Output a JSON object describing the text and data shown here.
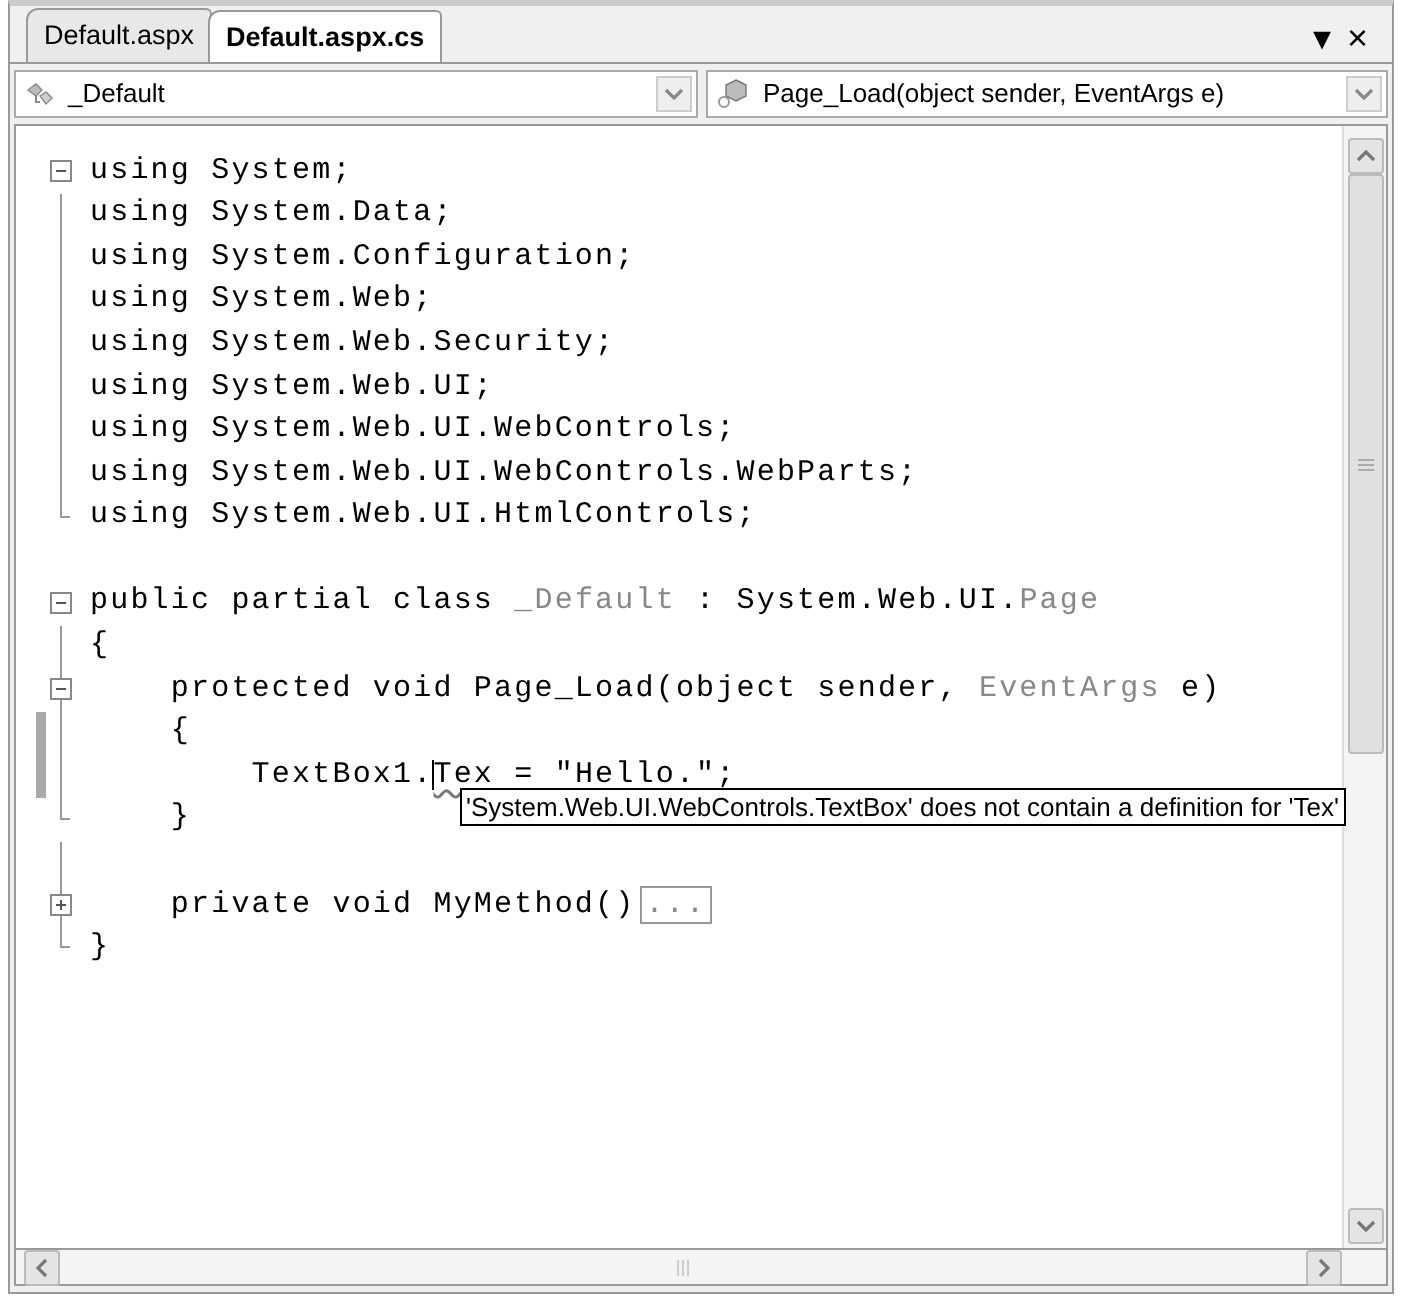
{
  "tabs": [
    {
      "label": "Default.aspx",
      "selected": false
    },
    {
      "label": "Default.aspx.cs",
      "selected": true
    }
  ],
  "window_buttons": {
    "menu": "▾",
    "close": "×"
  },
  "type_dropdown": {
    "value": "_Default"
  },
  "member_dropdown": {
    "value": "Page_Load(object sender, EventArgs e)"
  },
  "code_lines": [
    {
      "kind": "fold_start",
      "expanded": true,
      "changed": false,
      "tokens": [
        {
          "text": "using System;",
          "kind": "code"
        }
      ]
    },
    {
      "kind": "guide",
      "changed": false,
      "tokens": [
        {
          "text": "using System.Data;",
          "kind": "code"
        }
      ]
    },
    {
      "kind": "guide",
      "changed": false,
      "tokens": [
        {
          "text": "using System.Configuration;",
          "kind": "code"
        }
      ]
    },
    {
      "kind": "guide",
      "changed": false,
      "tokens": [
        {
          "text": "using System.Web;",
          "kind": "code"
        }
      ]
    },
    {
      "kind": "guide",
      "changed": false,
      "tokens": [
        {
          "text": "using System.Web.Security;",
          "kind": "code"
        }
      ]
    },
    {
      "kind": "guide",
      "changed": false,
      "tokens": [
        {
          "text": "using System.Web.UI;",
          "kind": "code"
        }
      ]
    },
    {
      "kind": "guide",
      "changed": false,
      "tokens": [
        {
          "text": "using System.Web.UI.WebControls;",
          "kind": "code"
        }
      ]
    },
    {
      "kind": "guide",
      "changed": false,
      "tokens": [
        {
          "text": "using System.Web.UI.WebControls.WebParts;",
          "kind": "code"
        }
      ]
    },
    {
      "kind": "guide_end",
      "changed": false,
      "tokens": [
        {
          "text": "using System.Web.UI.HtmlControls;",
          "kind": "code"
        }
      ]
    },
    {
      "kind": "plain",
      "changed": false
    },
    {
      "kind": "fold_start",
      "expanded": true,
      "changed": false,
      "tokens": [
        {
          "text": "public partial class ",
          "kind": "code"
        },
        {
          "text": "_Default",
          "kind": "type"
        },
        {
          "text": " : System.Web.UI.",
          "kind": "code"
        },
        {
          "text": "Page",
          "kind": "type"
        }
      ]
    },
    {
      "kind": "guide",
      "changed": false,
      "tokens": [
        {
          "text": "{",
          "kind": "code"
        }
      ]
    },
    {
      "kind": "fold_start",
      "expanded": true,
      "changed": false,
      "tokens": [
        {
          "text": "    protected void Page_Load(object sender, ",
          "kind": "code"
        },
        {
          "text": "EventArgs",
          "kind": "type"
        },
        {
          "text": " e)",
          "kind": "code"
        }
      ]
    },
    {
      "kind": "guide",
      "changed": true,
      "tokens": [
        {
          "text": "    {",
          "kind": "code"
        }
      ]
    },
    {
      "kind": "guide",
      "changed": true,
      "tokens": [
        {
          "text": "        TextBox1.",
          "kind": "code"
        },
        {
          "text": "Tex",
          "kind": "error",
          "caret": true
        },
        {
          "text": " = \"Hello.\";",
          "kind": "code"
        }
      ]
    },
    {
      "kind": "guide_end",
      "changed": false,
      "tokens": [
        {
          "text": "    }",
          "kind": "code"
        }
      ]
    },
    {
      "kind": "guide",
      "changed": false
    },
    {
      "kind": "fold_start",
      "expanded": false,
      "changed": false,
      "tokens": [
        {
          "text": "    private void MyMethod()",
          "kind": "code"
        },
        {
          "text": "...",
          "kind": "collapsed"
        }
      ]
    },
    {
      "kind": "guide_end",
      "changed": false,
      "tokens": [
        {
          "text": "}",
          "kind": "code"
        }
      ]
    }
  ],
  "tooltip": {
    "text": "'System.Web.UI.WebControls.TextBox' does not contain a definition for 'Tex'"
  }
}
